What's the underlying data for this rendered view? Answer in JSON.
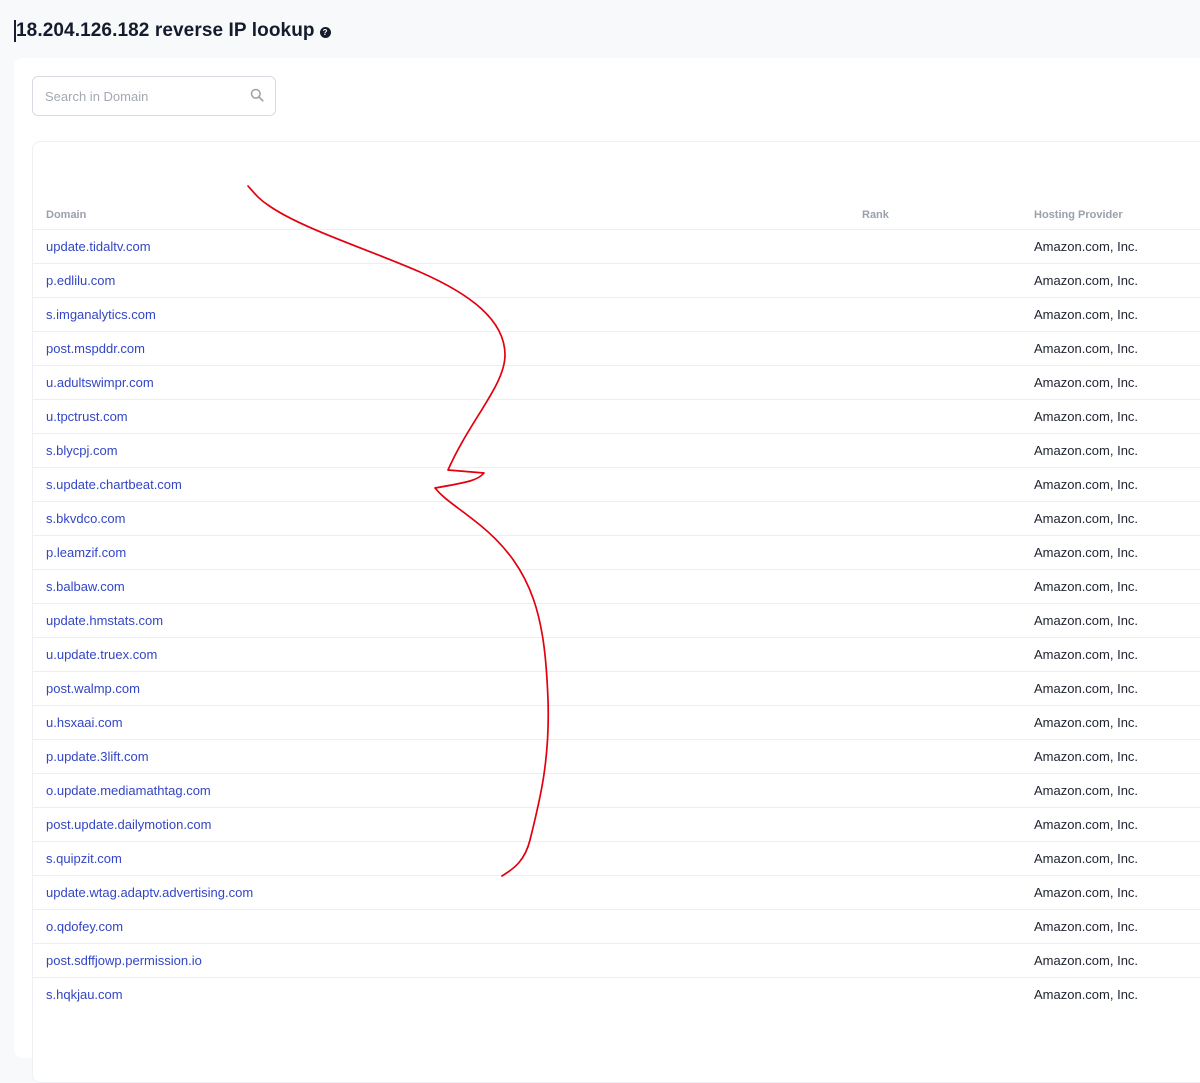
{
  "header": {
    "title": "18.204.126.182 reverse IP lookup",
    "help_icon": "question-circle-icon",
    "help_glyph": "?"
  },
  "search": {
    "placeholder": "Search in Domain",
    "value": "",
    "icon": "search-icon"
  },
  "table": {
    "columns": {
      "domain": "Domain",
      "rank": "Rank",
      "provider": "Hosting Provider"
    },
    "rows": [
      {
        "domain": "update.tidaltv.com",
        "rank": "",
        "provider": "Amazon.com, Inc."
      },
      {
        "domain": "p.edlilu.com",
        "rank": "",
        "provider": "Amazon.com, Inc."
      },
      {
        "domain": "s.imganalytics.com",
        "rank": "",
        "provider": "Amazon.com, Inc."
      },
      {
        "domain": "post.mspddr.com",
        "rank": "",
        "provider": "Amazon.com, Inc."
      },
      {
        "domain": "u.adultswimpr.com",
        "rank": "",
        "provider": "Amazon.com, Inc."
      },
      {
        "domain": "u.tpctrust.com",
        "rank": "",
        "provider": "Amazon.com, Inc."
      },
      {
        "domain": "s.blycpj.com",
        "rank": "",
        "provider": "Amazon.com, Inc."
      },
      {
        "domain": "s.update.chartbeat.com",
        "rank": "",
        "provider": "Amazon.com, Inc."
      },
      {
        "domain": "s.bkvdco.com",
        "rank": "",
        "provider": "Amazon.com, Inc."
      },
      {
        "domain": "p.leamzif.com",
        "rank": "",
        "provider": "Amazon.com, Inc."
      },
      {
        "domain": "s.balbaw.com",
        "rank": "",
        "provider": "Amazon.com, Inc."
      },
      {
        "domain": "update.hmstats.com",
        "rank": "",
        "provider": "Amazon.com, Inc."
      },
      {
        "domain": "u.update.truex.com",
        "rank": "",
        "provider": "Amazon.com, Inc."
      },
      {
        "domain": "post.walmp.com",
        "rank": "",
        "provider": "Amazon.com, Inc."
      },
      {
        "domain": "u.hsxaai.com",
        "rank": "",
        "provider": "Amazon.com, Inc."
      },
      {
        "domain": "p.update.3lift.com",
        "rank": "",
        "provider": "Amazon.com, Inc."
      },
      {
        "domain": "o.update.mediamathtag.com",
        "rank": "",
        "provider": "Amazon.com, Inc."
      },
      {
        "domain": "post.update.dailymotion.com",
        "rank": "",
        "provider": "Amazon.com, Inc."
      },
      {
        "domain": "s.quipzit.com",
        "rank": "",
        "provider": "Amazon.com, Inc."
      },
      {
        "domain": "update.wtag.adaptv.advertising.com",
        "rank": "",
        "provider": "Amazon.com, Inc."
      },
      {
        "domain": "o.qdofey.com",
        "rank": "",
        "provider": "Amazon.com, Inc."
      },
      {
        "domain": "post.sdffjowp.permission.io",
        "rank": "",
        "provider": "Amazon.com, Inc."
      },
      {
        "domain": "s.hqkjau.com",
        "rank": "",
        "provider": "Amazon.com, Inc."
      }
    ]
  },
  "colors": {
    "link": "#3346c4",
    "annotation_stroke": "#e3000f",
    "page_bg": "#f8f9fa"
  }
}
